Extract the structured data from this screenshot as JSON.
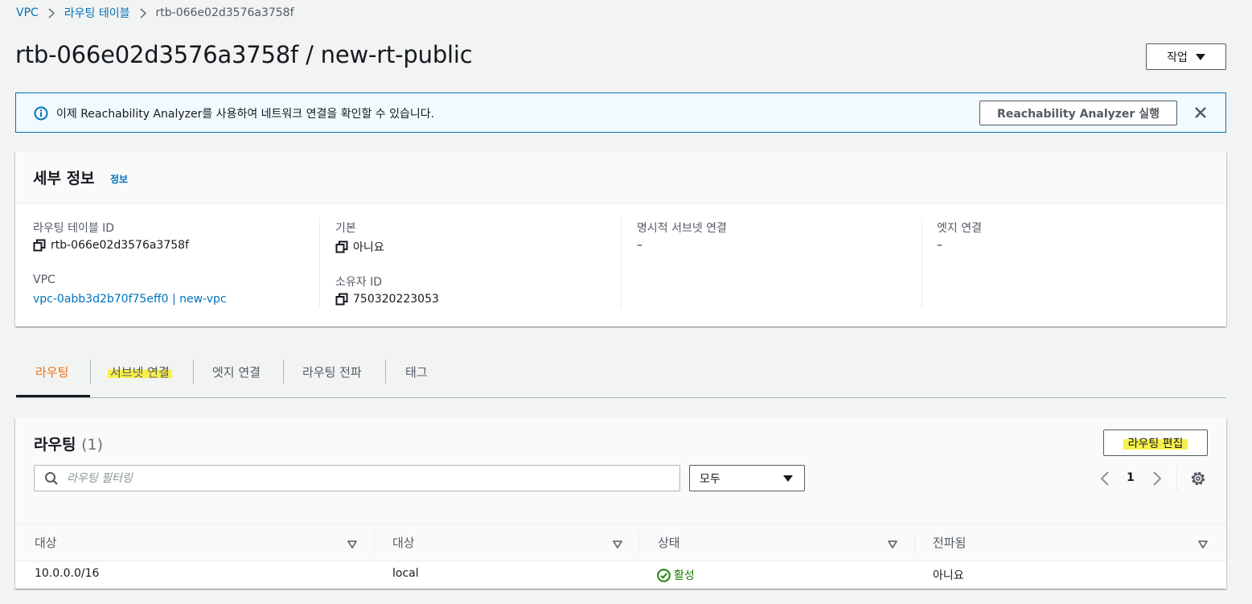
{
  "breadcrumb": {
    "items": [
      {
        "label": "VPC"
      },
      {
        "label": "라우팅 테이블"
      },
      {
        "label": "rtb-066e02d3576a3758f"
      }
    ]
  },
  "page": {
    "title": "rtb-066e02d3576a3758f / new-rt-public",
    "actions_label": "작업"
  },
  "banner": {
    "message": "이제 Reachability Analyzer를 사용하여 네트워크 연결을 확인할 수 있습니다.",
    "button_label": "Reachability Analyzer 실행"
  },
  "details": {
    "title": "세부 정보",
    "info_link": "정보",
    "fields": {
      "route_table_id_label": "라우팅 테이블 ID",
      "route_table_id_value": "rtb-066e02d3576a3758f",
      "vpc_label": "VPC",
      "vpc_value": "vpc-0abb3d2b70f75eff0 | new-vpc",
      "main_label": "기본",
      "main_value": "아니요",
      "owner_label": "소유자 ID",
      "owner_value": "750320223053",
      "explicit_subnet_label": "명시적 서브넷 연결",
      "explicit_subnet_value": "–",
      "edge_label": "엣지 연결",
      "edge_value": "–"
    }
  },
  "tabs": [
    {
      "label": "라우팅",
      "active": true
    },
    {
      "label": "서브넷 연결",
      "active": false
    },
    {
      "label": "엣지 연결",
      "active": false
    },
    {
      "label": "라우팅 전파",
      "active": false
    },
    {
      "label": "태그",
      "active": false
    }
  ],
  "routes": {
    "title": "라우팅",
    "count": "(1)",
    "edit_button": "라우팅 편집",
    "filter_placeholder": "라우팅 필터링",
    "select_value": "모두",
    "page_number": "1",
    "columns": [
      "대상",
      "대상",
      "상태",
      "전파됨"
    ],
    "rows": [
      {
        "destination": "10.0.0.0/16",
        "target": "local",
        "status": "활성",
        "propagated": "아니요"
      }
    ]
  },
  "colors": {
    "accent_link": "#0073bb",
    "active_tab": "#ec7211",
    "status_active": "#1d8102",
    "highlight": "#f7f04b"
  },
  "icons": [
    "chevron-right-icon",
    "caret-down-icon",
    "info-icon",
    "close-icon",
    "copy-icon",
    "search-icon",
    "chevron-left-icon",
    "settings-icon",
    "sort-icon",
    "status-success-icon"
  ]
}
